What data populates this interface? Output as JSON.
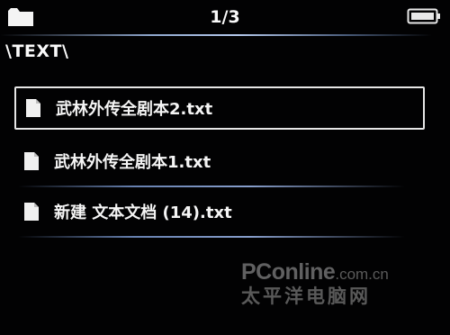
{
  "header": {
    "folder_icon": "folder-icon",
    "page_indicator": "1/3",
    "battery_icon": "battery-icon"
  },
  "path": "\\TEXT\\",
  "files": [
    {
      "name": "武林外传全剧本2.txt",
      "icon": "document-icon",
      "selected": true
    },
    {
      "name": "武林外传全剧本1.txt",
      "icon": "document-icon",
      "selected": false
    },
    {
      "name": "新建 文本文档 (14).txt",
      "icon": "document-icon",
      "selected": false
    }
  ],
  "watermark": {
    "brand": "PConline",
    "domain": ".com.cn",
    "chinese": "太平洋电脑网"
  },
  "colors": {
    "background": "#020203",
    "text": "#f2f2f2",
    "divider": "#a0b4dc",
    "selection_border": "#e6e6e6"
  }
}
